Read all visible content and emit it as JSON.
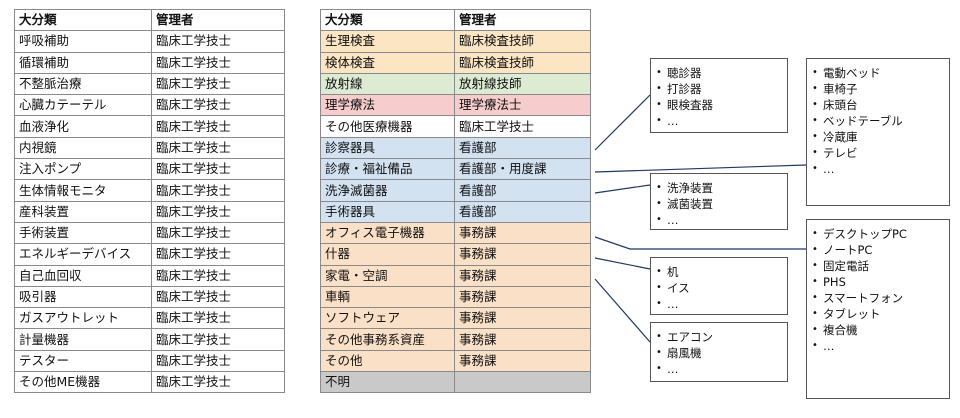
{
  "colors": {
    "yellow": "#fbe5c3",
    "green": "#ddebd3",
    "pink": "#f6cccc",
    "white": "#ffffff",
    "blue": "#d3e2f1",
    "orange": "#fbe0c8",
    "gray": "#c9c9c9",
    "connector": "#1f3864"
  },
  "table1": {
    "headers": [
      "大分類",
      "管理者"
    ],
    "rows": [
      [
        "呼吸補助",
        "臨床工学技士"
      ],
      [
        "循環補助",
        "臨床工学技士"
      ],
      [
        "不整脈治療",
        "臨床工学技士"
      ],
      [
        "心臓カテーテル",
        "臨床工学技士"
      ],
      [
        "血液浄化",
        "臨床工学技士"
      ],
      [
        "内視鏡",
        "臨床工学技士"
      ],
      [
        "注入ポンプ",
        "臨床工学技士"
      ],
      [
        "生体情報モニタ",
        "臨床工学技士"
      ],
      [
        "産科装置",
        "臨床工学技士"
      ],
      [
        "手術装置",
        "臨床工学技士"
      ],
      [
        "エネルギーデバイス",
        "臨床工学技士"
      ],
      [
        "自己血回収",
        "臨床工学技士"
      ],
      [
        "吸引器",
        "臨床工学技士"
      ],
      [
        "ガスアウトレット",
        "臨床工学技士"
      ],
      [
        "計量機器",
        "臨床工学技士"
      ],
      [
        "テスター",
        "臨床工学技士"
      ],
      [
        "その他ME機器",
        "臨床工学技士"
      ]
    ]
  },
  "table2": {
    "headers": [
      "大分類",
      "管理者"
    ],
    "rows": [
      {
        "c": [
          "生理検査",
          "臨床検査技師"
        ],
        "color": "yellow"
      },
      {
        "c": [
          "検体検査",
          "臨床検査技師"
        ],
        "color": "yellow"
      },
      {
        "c": [
          "放射線",
          "放射線技師"
        ],
        "color": "green"
      },
      {
        "c": [
          "理学療法",
          "理学療法士"
        ],
        "color": "pink"
      },
      {
        "c": [
          "その他医療機器",
          "臨床工学技士"
        ],
        "color": "white"
      },
      {
        "c": [
          "診察器具",
          "看護部"
        ],
        "color": "blue"
      },
      {
        "c": [
          "診療・福祉備品",
          "看護部・用度課"
        ],
        "color": "blue"
      },
      {
        "c": [
          "洗浄滅菌器",
          "看護部"
        ],
        "color": "blue"
      },
      {
        "c": [
          "手術器具",
          "看護部"
        ],
        "color": "blue"
      },
      {
        "c": [
          "オフィス電子機器",
          "事務課"
        ],
        "color": "orange"
      },
      {
        "c": [
          "什器",
          "事務課"
        ],
        "color": "orange"
      },
      {
        "c": [
          "家電・空調",
          "事務課"
        ],
        "color": "orange"
      },
      {
        "c": [
          "車輌",
          "事務課"
        ],
        "color": "orange"
      },
      {
        "c": [
          "ソフトウェア",
          "事務課"
        ],
        "color": "orange"
      },
      {
        "c": [
          "その他事務系資産",
          "事務課"
        ],
        "color": "orange"
      },
      {
        "c": [
          "その他",
          "事務課"
        ],
        "color": "orange"
      },
      {
        "c": [
          "不明",
          ""
        ],
        "color": "gray"
      }
    ]
  },
  "boxes": {
    "shinsatsu": [
      "聴診器",
      "打診器",
      "眼検査器",
      "…"
    ],
    "senjou": [
      "洗浄装置",
      "滅菌装置",
      "…"
    ],
    "juuki": [
      "机",
      "イス",
      "…"
    ],
    "kaden": [
      "エアコン",
      "扇風機",
      "…"
    ],
    "fukushi": [
      "電動ベッド",
      "車椅子",
      "床頭台",
      "ベッドテーブル",
      "冷蔵庫",
      "テレビ",
      "…"
    ],
    "office": [
      "デスクトップPC",
      "ノートPC",
      "固定電話",
      "PHS",
      "スマートフォン",
      "タブレット",
      "複合機",
      "…"
    ]
  }
}
